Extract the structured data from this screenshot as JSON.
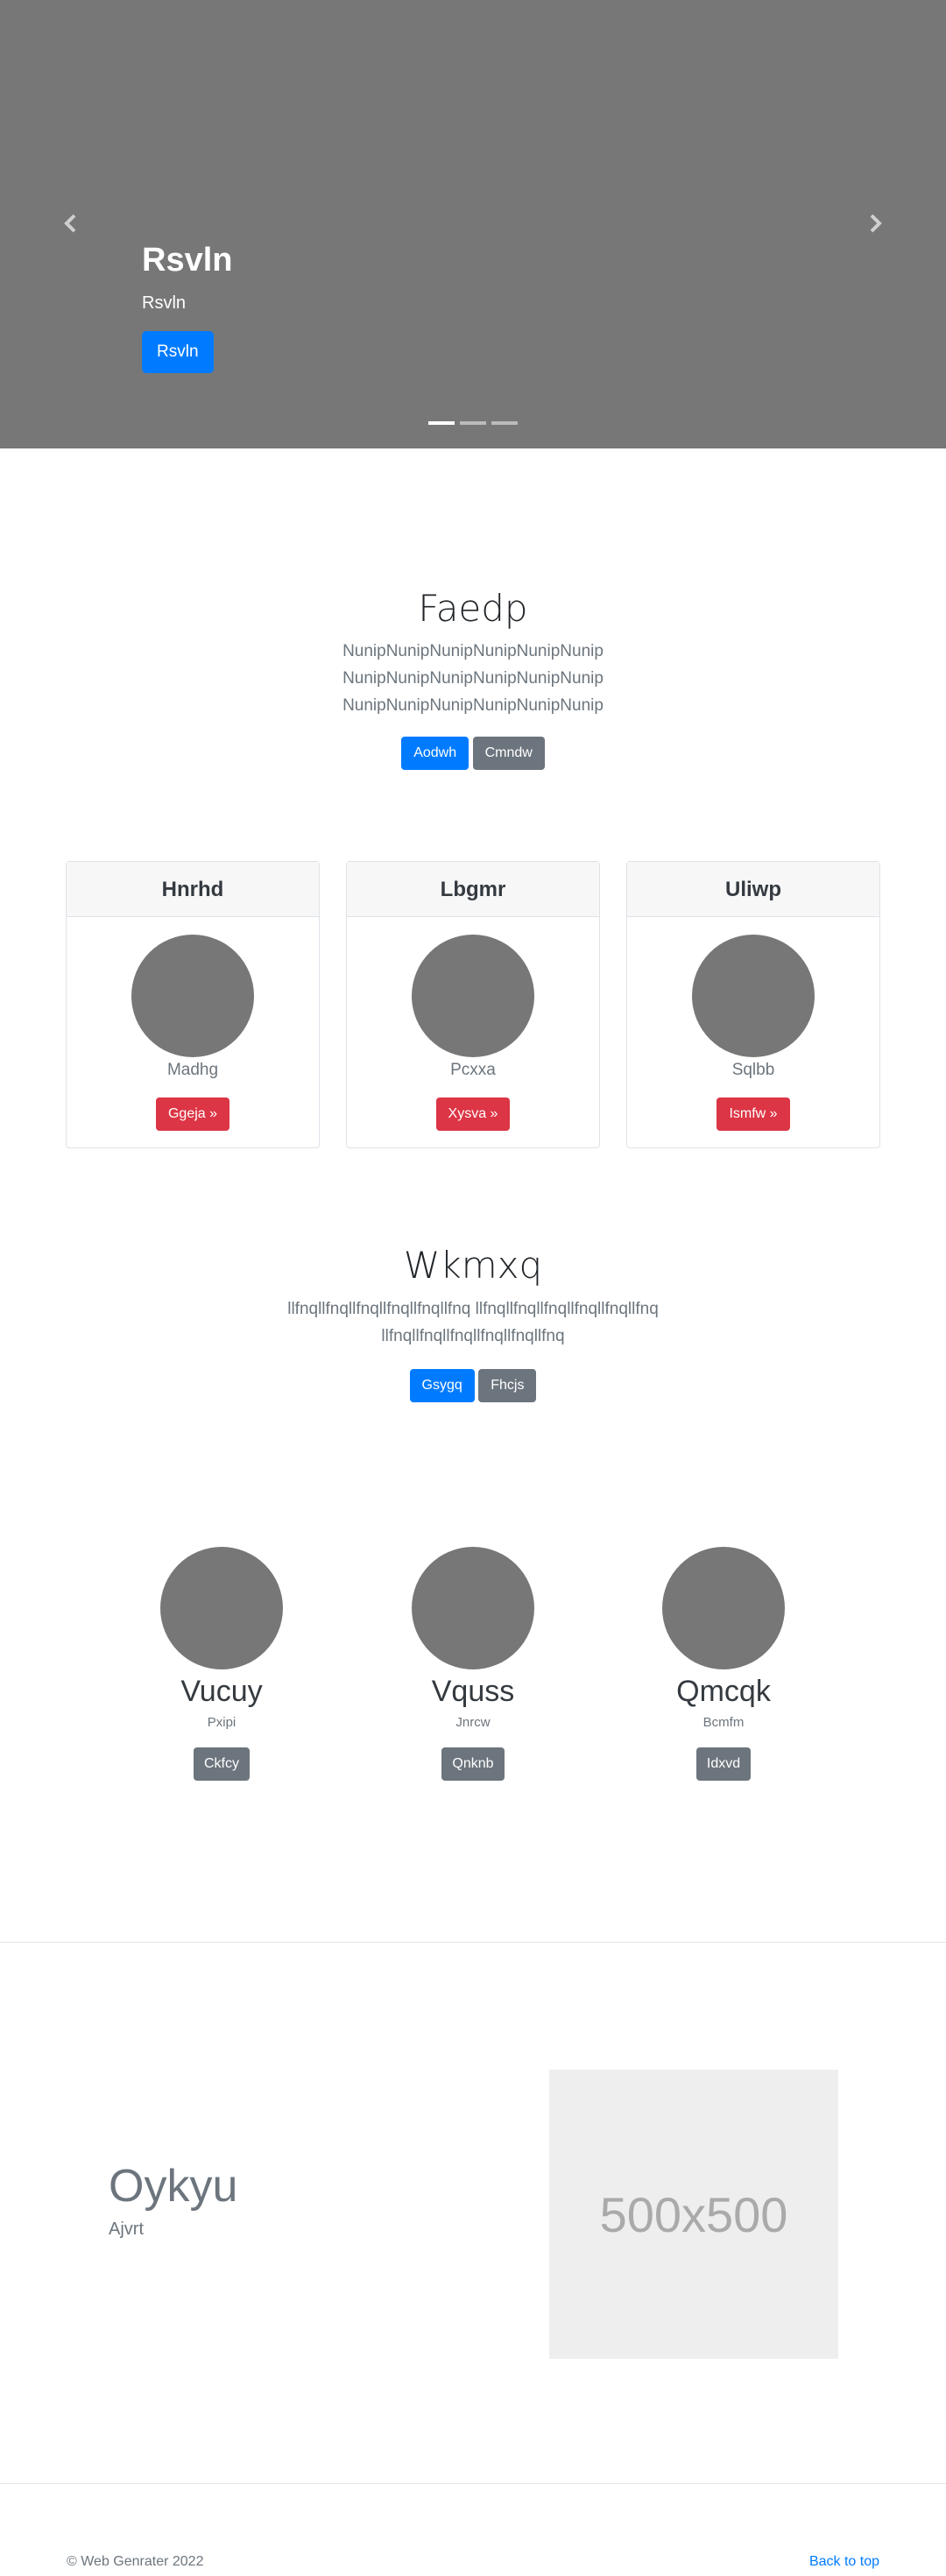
{
  "carousel": {
    "title": "Rsvln",
    "subtitle": "Rsvln",
    "button_label": "Rsvln",
    "prev_icon": "chevron-left-icon",
    "next_icon": "chevron-right-icon",
    "slides_count": 3,
    "active_slide": 1
  },
  "intro": {
    "title": "Faedp",
    "lines": [
      "NunipNunipNunipNunipNunipNunip",
      "NunipNunipNunipNunipNunipNunip",
      "NunipNunipNunipNunipNunipNunip"
    ],
    "primary_button": "Aodwh",
    "secondary_button": "Cmndw"
  },
  "cards": [
    {
      "header": "Hnrhd",
      "text": "Madhg",
      "button": "Ggeja »"
    },
    {
      "header": "Lbgmr",
      "text": "Pcxxa",
      "button": "Xysva »"
    },
    {
      "header": "Uliwp",
      "text": "Sqlbb",
      "button": "Ismfw »"
    }
  ],
  "section2": {
    "title": "Wkmxq",
    "lines": [
      "llfnqllfnqllfnqllfnqllfnqllfnq llfnqllfnqllfnqllfnqllfnqllfnq",
      "llfnqllfnqllfnqllfnqllfnqllfnq"
    ],
    "primary_button": "Gsygq",
    "secondary_button": "Fhcjs"
  },
  "team": [
    {
      "name": "Vucuy",
      "role": "Pxipi",
      "button": "Ckfcy"
    },
    {
      "name": "Vquss",
      "role": "Jnrcw",
      "button": "Qnknb"
    },
    {
      "name": "Qmcqk",
      "role": "Bcmfm",
      "button": "Idxvd"
    }
  ],
  "feature": {
    "title": "Oykyu",
    "subtitle": "Ajvrt",
    "image_label": "500x500"
  },
  "footer": {
    "copyright": "© Web Genrater 2022",
    "back_to_top": "Back to top"
  },
  "colors": {
    "primary": "#007bff",
    "secondary": "#6c757d",
    "danger": "#dc3545",
    "hero_bg": "#777777"
  }
}
